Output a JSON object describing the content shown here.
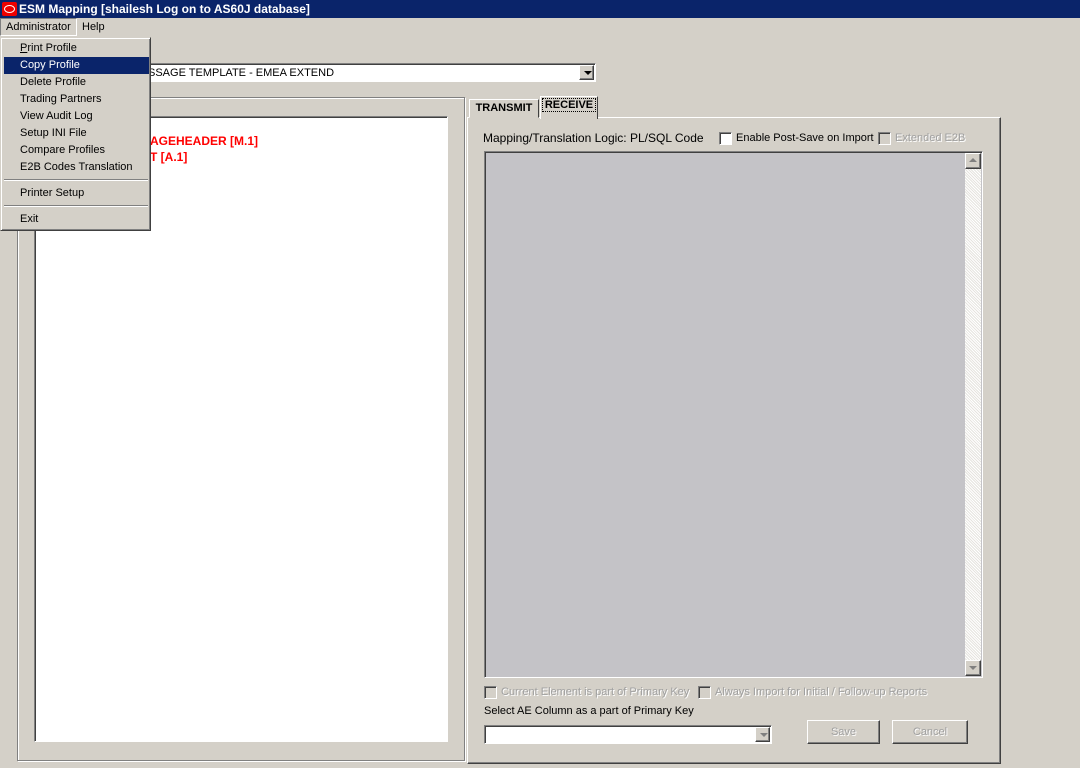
{
  "window": {
    "title": "ESM Mapping [shailesh Log on to AS60J database]"
  },
  "menubar": {
    "items": [
      {
        "label": "Administrator"
      },
      {
        "label": "Help"
      }
    ]
  },
  "admin_menu": {
    "items": [
      {
        "label": "Print Profile"
      },
      {
        "label": "Copy Profile",
        "highlighted": true
      },
      {
        "label": "Delete Profile"
      },
      {
        "label": "Trading Partners"
      },
      {
        "label": "View Audit Log"
      },
      {
        "label": "Setup INI File"
      },
      {
        "label": "Compare Profiles"
      },
      {
        "label": "E2B Codes Translation"
      },
      {
        "label": "Printer Setup"
      },
      {
        "label": "Exit"
      }
    ]
  },
  "profile_combo": {
    "value": "SSAGE TEMPLATE - EMEA EXTEND"
  },
  "tree": {
    "items": [
      {
        "label": "AGEHEADER [M.1]"
      },
      {
        "label": "T [A.1]"
      }
    ]
  },
  "tabs": [
    {
      "label": "TRANSMIT"
    },
    {
      "label": "RECEIVE",
      "selected": true
    }
  ],
  "receive": {
    "logic_label": "Mapping/Translation Logic: PL/SQL Code",
    "enable_post_save": {
      "label": "Enable Post-Save on Import",
      "checked": false
    },
    "extended_e2b": {
      "label": "Extended E2B",
      "checked": false,
      "disabled": true
    },
    "code_text": "",
    "primary_key_cb": {
      "label": "Current Element is part of Primary Key",
      "disabled": true
    },
    "always_import_cb": {
      "label": "Always Import for Initial / Follow-up Reports",
      "disabled": true
    },
    "ae_column_label": "Select AE Column as a part of Primary Key",
    "ae_column_value": "",
    "save_label": "Save",
    "cancel_label": "Cancel"
  },
  "colors": {
    "titlebar": "#0a246a",
    "tree_text": "#ff0000",
    "code_bg": "#c4c3c7"
  }
}
